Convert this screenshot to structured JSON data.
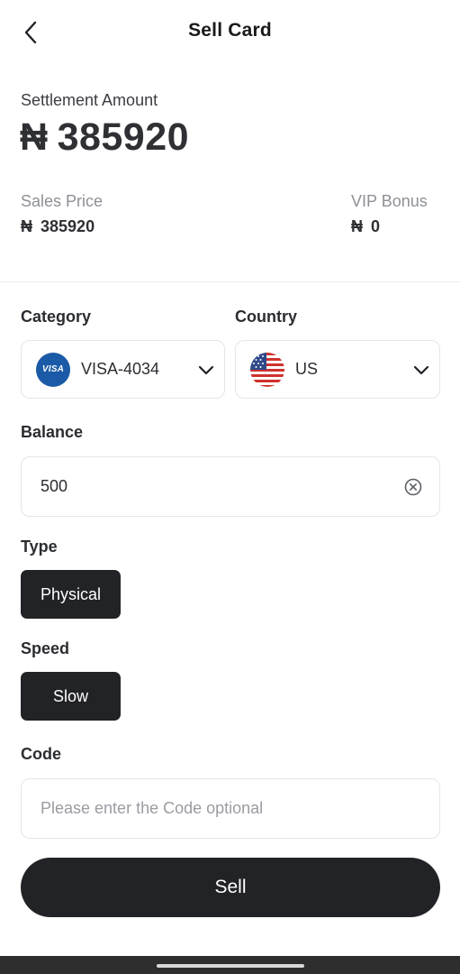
{
  "header": {
    "title": "Sell Card",
    "back_icon": "chevron-left-icon"
  },
  "settlement": {
    "label": "Settlement Amount",
    "currency_symbol": "₦",
    "amount": "385920"
  },
  "sales_price": {
    "label": "Sales Price",
    "currency_symbol": "₦",
    "value": "385920"
  },
  "vip_bonus": {
    "label": "VIP Bonus",
    "currency_symbol": "₦",
    "value": "0"
  },
  "category": {
    "label": "Category",
    "selected": "VISA-4034",
    "badge_text": "VISA",
    "badge_color": "#1a5aa6"
  },
  "country": {
    "label": "Country",
    "selected": "US",
    "flag_icon": "us-flag-icon"
  },
  "balance": {
    "label": "Balance",
    "value": "500"
  },
  "type": {
    "label": "Type",
    "selected": "Physical"
  },
  "speed": {
    "label": "Speed",
    "selected": "Slow"
  },
  "code": {
    "label": "Code",
    "value": "",
    "placeholder": "Please enter the Code optional"
  },
  "actions": {
    "sell_label": "Sell"
  },
  "colors": {
    "primary_dark": "#222326",
    "text": "#2b2d31",
    "muted": "#8d9096",
    "border": "#e4e5e8"
  }
}
